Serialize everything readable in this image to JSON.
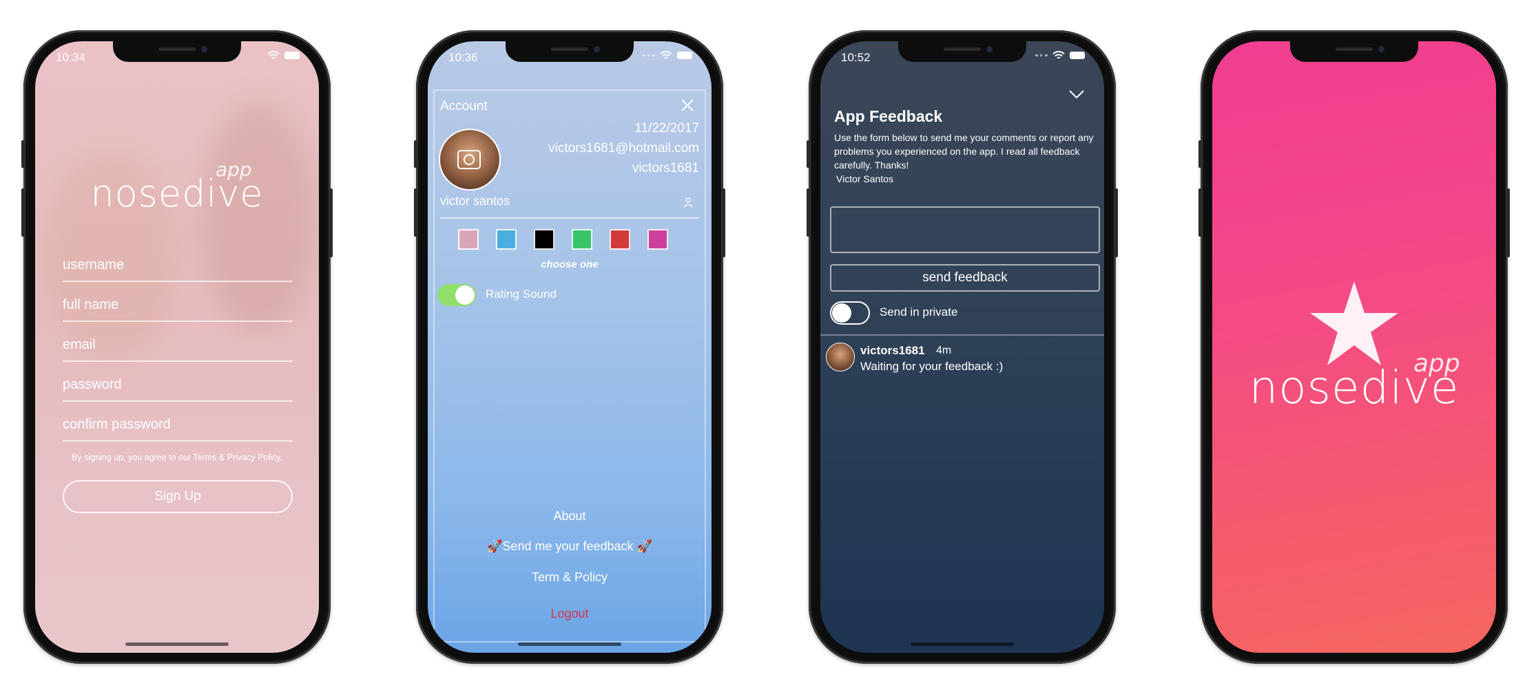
{
  "screens": [
    {
      "status_time": "10:34",
      "logo": {
        "main": "nosedive",
        "sub": "app"
      },
      "fields": {
        "username": "username",
        "full_name": "full name",
        "email": "email",
        "password": "password",
        "confirm_password": "confirm password"
      },
      "terms": "By signing up, you agree to our Terms & Privacy Policy.",
      "signup_button": "Sign Up"
    },
    {
      "status_time": "10:36",
      "panel_title": "Account",
      "date": "11/22/2017",
      "email": "victors1681@hotmail.com",
      "username": "victors1681",
      "name_field": "victor santos",
      "swatches": [
        "#d8a6bb",
        "#4aaee0",
        "#000000",
        "#38c56a",
        "#d43a3a",
        "#cc3f9c"
      ],
      "choose_label": "choose one",
      "rating_sound": {
        "label": "Rating Sound",
        "on": true
      },
      "menu": {
        "about": "About",
        "feedback": "🚀Send me your feedback 🚀",
        "terms": "Term & Policy",
        "logout": "Logout"
      }
    },
    {
      "status_time": "10:52",
      "title": "App Feedback",
      "description": "Use the form below to send me your comments or report any problems you experienced on the app. I read all feedback carefully. Thanks!",
      "signature": "Victor Santos",
      "input_value": "",
      "send_button": "send feedback",
      "private_toggle": {
        "label": "Send in private",
        "on": false
      },
      "comment": {
        "user": "victors1681",
        "time": "4m",
        "text": "Waiting for your feedback :)"
      }
    },
    {
      "logo": {
        "main": "nosedive",
        "sub": "app"
      }
    }
  ],
  "colors": {
    "screen1_bg": "#e8c0c4",
    "screen2_bg": "#9cbde8",
    "screen3_bg": "#2c3e55",
    "screen4_bg": "#f34a7c",
    "toggle_on": "#8ee06a",
    "logout": "#d9354a"
  }
}
